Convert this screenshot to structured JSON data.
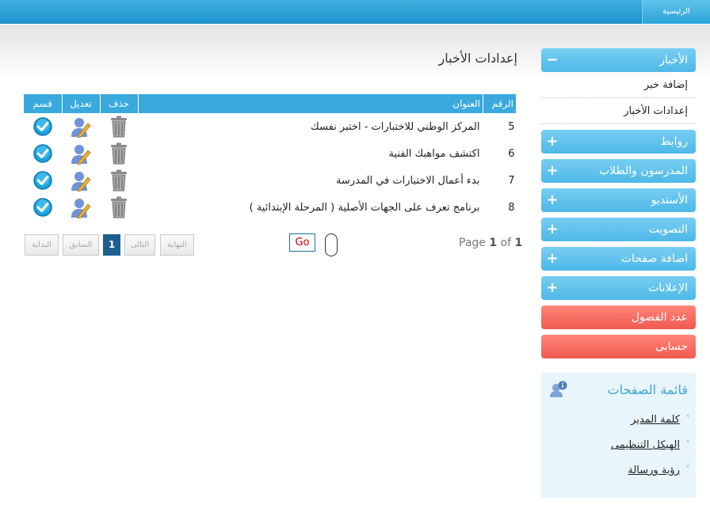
{
  "topnav": {
    "home": "الرئيسية"
  },
  "sidebar": {
    "news": {
      "label": "الأخبار",
      "sign": "−"
    },
    "news_items": [
      "إضافة خبر",
      "إعدادات الأخبار"
    ],
    "items": [
      {
        "label": "روابط",
        "sign": "+"
      },
      {
        "label": "المدرسون والطلاب",
        "sign": "+"
      },
      {
        "label": "الأستديو",
        "sign": "+"
      },
      {
        "label": "التصويت",
        "sign": "+"
      },
      {
        "label": "اضافة صفحات",
        "sign": "+"
      },
      {
        "label": "الإعلانات",
        "sign": "+"
      }
    ],
    "red_items": [
      "عدد الفصول",
      "حسابى"
    ]
  },
  "pages_box": {
    "title": "قائمة الصفحات",
    "links": [
      "كلمة المدير",
      "الهيكل التنظيمى",
      "رؤية ورسالة"
    ]
  },
  "main": {
    "title": "إعدادات الأخبار",
    "headers": {
      "num": "الرقم",
      "title": "العنوان",
      "delete": "حذف",
      "edit": "تعديل",
      "section": "قسم"
    },
    "rows": [
      {
        "num": "5",
        "title": "المركز الوطني للاختبارات - اختبر نفسك"
      },
      {
        "num": "6",
        "title": "اكتشف مواهبك الفنية"
      },
      {
        "num": "7",
        "title": "بدء أعمال الاختبارات في المدرسة"
      },
      {
        "num": "8",
        "title": "برنامج تعرف على الجهات الأصلية ( المرحلة الإبتدائية )"
      }
    ]
  },
  "pager": {
    "page_word": "Page",
    "current": "1",
    "of_word": "of",
    "total": "1",
    "go": "Go",
    "end": "النهاية",
    "next": "التالى",
    "page_num": "1",
    "prev": "السابق",
    "start": "البداية"
  },
  "colors": {
    "topbar": "#1c94cc",
    "accordion_blue": "#4db8e8",
    "accordion_red": "#f05a4f",
    "table_header": "#3aa9de",
    "active_page": "#1d5f8f"
  },
  "icons": {
    "delete": "trash-icon",
    "edit": "user-edit-icon",
    "section": "check-circle-icon",
    "pages": "user-info-icon"
  }
}
